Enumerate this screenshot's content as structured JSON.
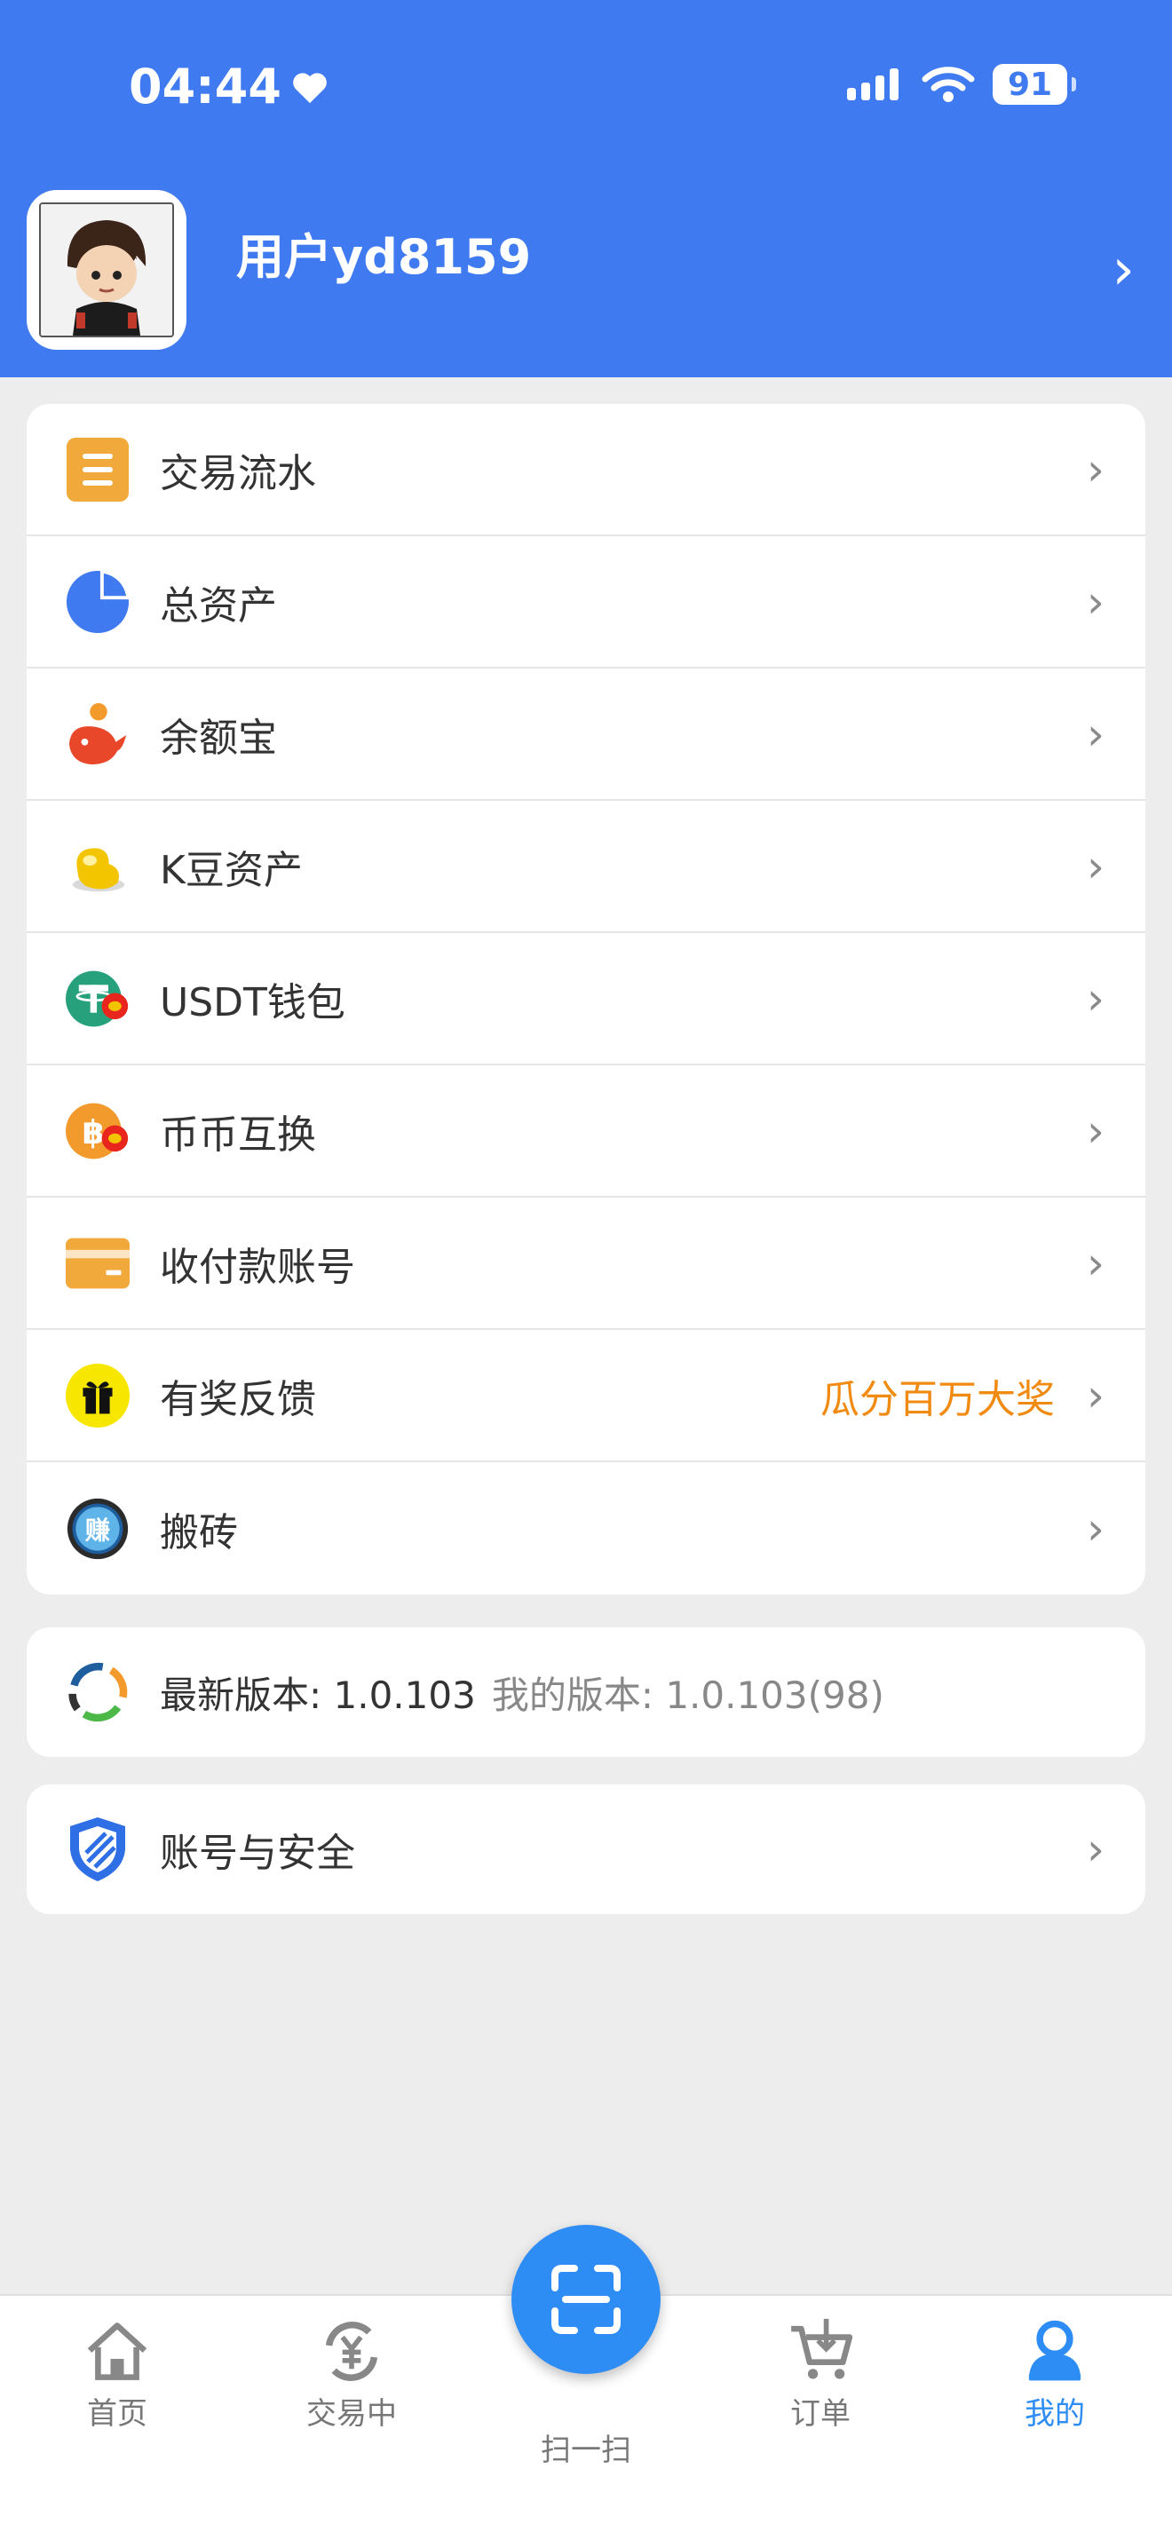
{
  "status_bar": {
    "time": "04:44",
    "battery": "91"
  },
  "profile": {
    "username": "用户yd8159"
  },
  "menu": [
    {
      "label": "交易流水",
      "icon": "ledger-icon"
    },
    {
      "label": "总资产",
      "icon": "pie-chart-icon"
    },
    {
      "label": "余额宝",
      "icon": "whale-icon"
    },
    {
      "label": "K豆资产",
      "icon": "bean-icon"
    },
    {
      "label": "USDT钱包",
      "icon": "tether-icon"
    },
    {
      "label": "币币互换",
      "icon": "bitcoin-icon"
    },
    {
      "label": "收付款账号",
      "icon": "card-icon"
    },
    {
      "label": "有奖反馈",
      "icon": "gift-icon",
      "extra": "瓜分百万大奖"
    },
    {
      "label": "搬砖",
      "icon": "earn-icon"
    }
  ],
  "version": {
    "latest_label": "最新版本: 1.0.103",
    "mine_label": "我的版本: 1.0.103(98)"
  },
  "security": {
    "label": "账号与安全"
  },
  "tabs": [
    {
      "label": "首页"
    },
    {
      "label": "交易中"
    },
    {
      "label": "扫一扫"
    },
    {
      "label": "订单"
    },
    {
      "label": "我的"
    }
  ],
  "colors": {
    "brand": "#3F7AF0",
    "accent": "#F08A10",
    "active_tab": "#2E8CF5"
  }
}
